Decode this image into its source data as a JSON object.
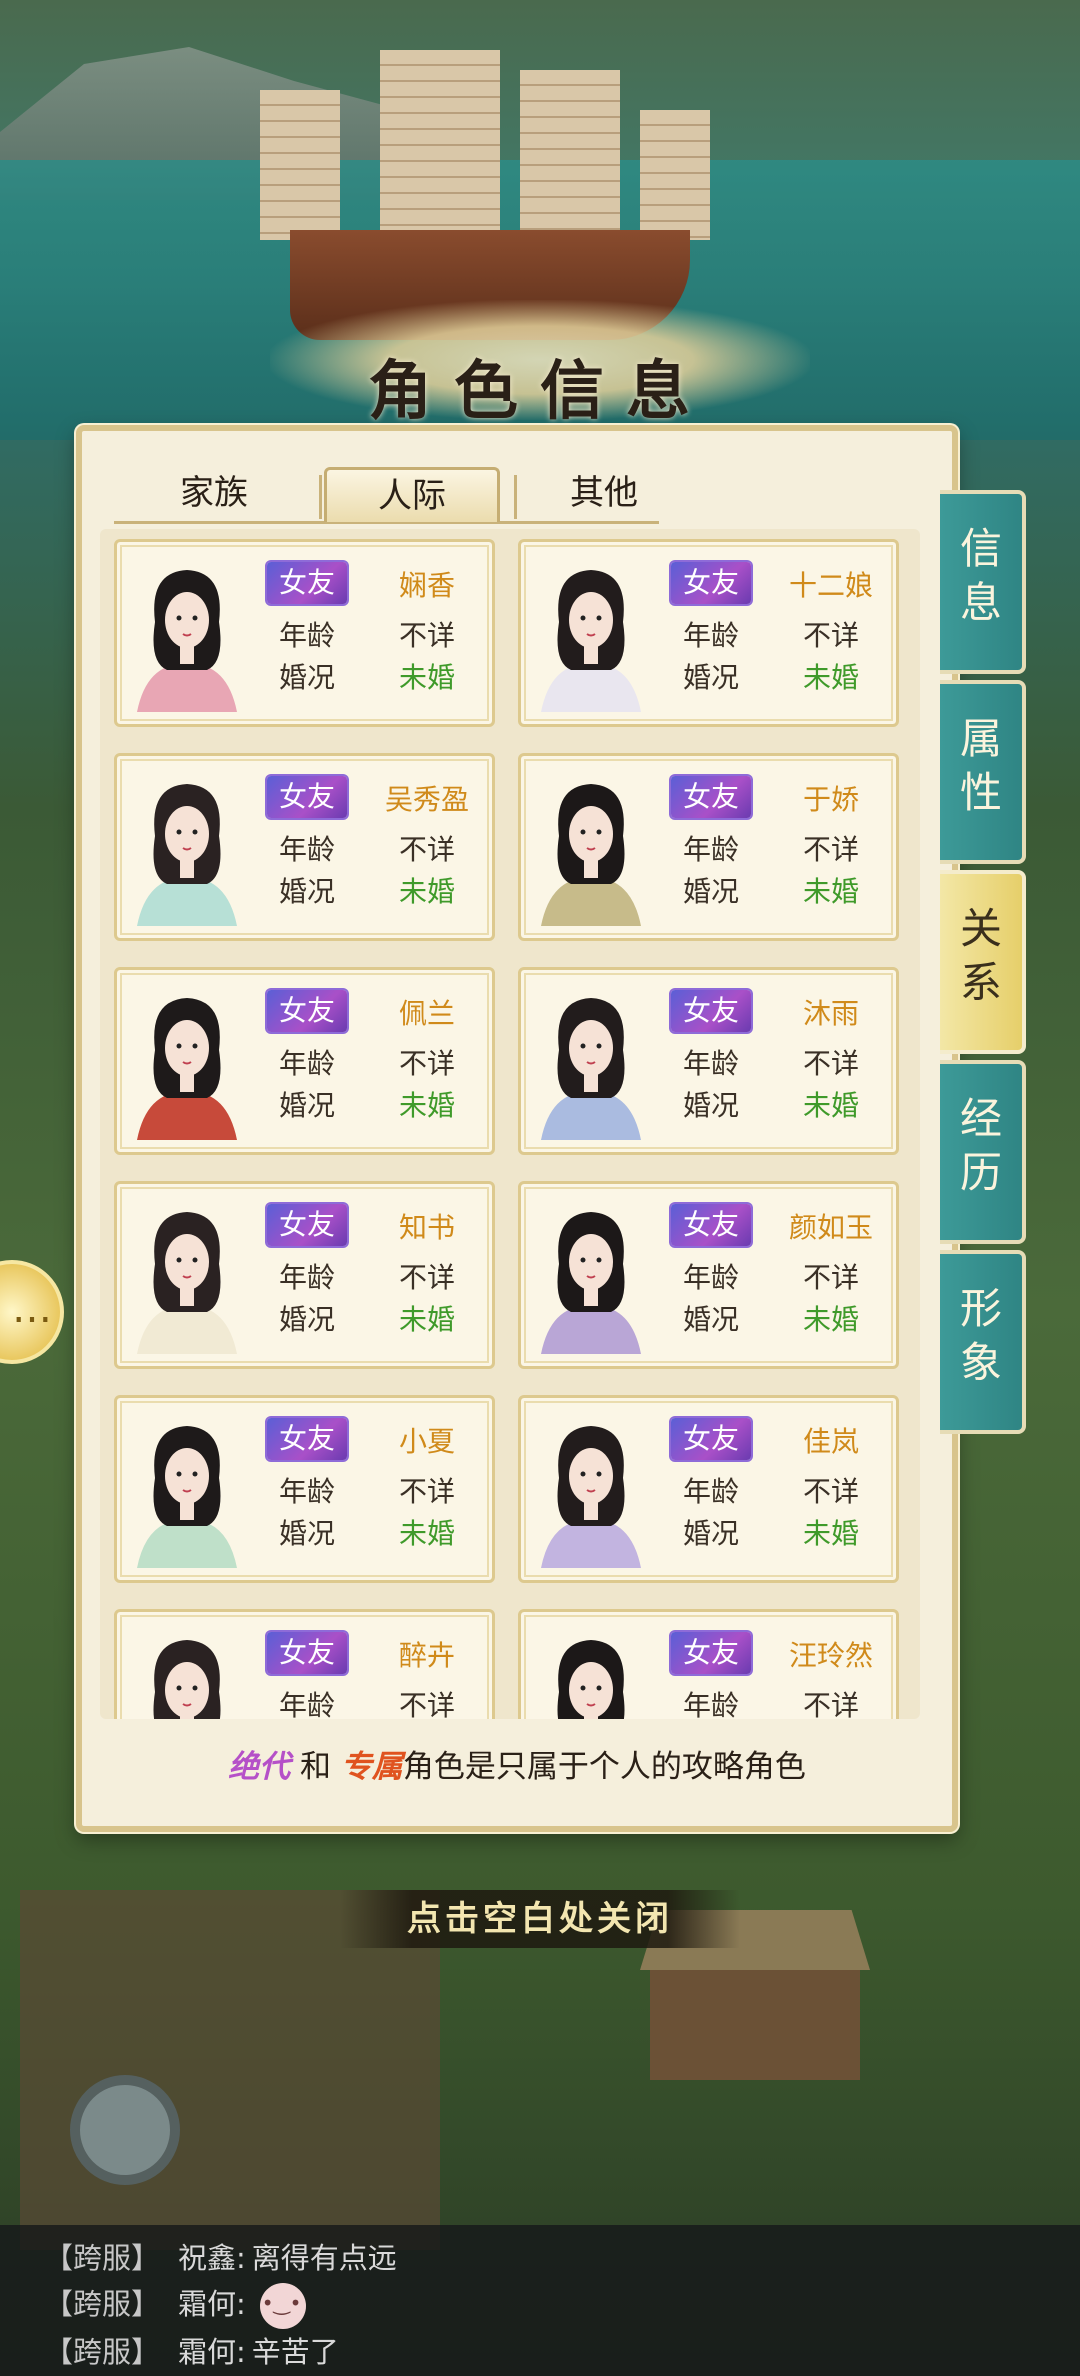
{
  "title": "角色信息",
  "tabs": [
    {
      "label": "家族",
      "active": false
    },
    {
      "label": "人际",
      "active": true
    },
    {
      "label": "其他",
      "active": false
    }
  ],
  "side_tabs": [
    {
      "label": "信息",
      "active": false
    },
    {
      "label": "属性",
      "active": false
    },
    {
      "label": "关系",
      "active": true
    },
    {
      "label": "经历",
      "active": false
    },
    {
      "label": "形象",
      "active": false
    }
  ],
  "labels": {
    "age": "年龄",
    "marital": "婚况"
  },
  "characters": [
    {
      "relation": "女友",
      "name": "娴香",
      "age": "不详",
      "marital": "未婚"
    },
    {
      "relation": "女友",
      "name": "十二娘",
      "age": "不详",
      "marital": "未婚"
    },
    {
      "relation": "女友",
      "name": "吴秀盈",
      "age": "不详",
      "marital": "未婚"
    },
    {
      "relation": "女友",
      "name": "于娇",
      "age": "不详",
      "marital": "未婚"
    },
    {
      "relation": "女友",
      "name": "佩兰",
      "age": "不详",
      "marital": "未婚"
    },
    {
      "relation": "女友",
      "name": "沐雨",
      "age": "不详",
      "marital": "未婚"
    },
    {
      "relation": "女友",
      "name": "知书",
      "age": "不详",
      "marital": "未婚"
    },
    {
      "relation": "女友",
      "name": "颜如玉",
      "age": "不详",
      "marital": "未婚"
    },
    {
      "relation": "女友",
      "name": "小夏",
      "age": "不详",
      "marital": "未婚"
    },
    {
      "relation": "女友",
      "name": "佳岚",
      "age": "不详",
      "marital": "未婚"
    },
    {
      "relation": "女友",
      "name": "醉卉",
      "age": "不详",
      "marital": ""
    },
    {
      "relation": "女友",
      "name": "汪玲然",
      "age": "不详",
      "marital": ""
    }
  ],
  "footer": {
    "tag1": "绝代",
    "mid": "和",
    "tag2": "专属",
    "text": "角色是只属于个人的攻略角色"
  },
  "close_hint": "点击空白处关闭",
  "chat": [
    {
      "server": "【跨服】",
      "user": "祝鑫:",
      "message": "离得有点远"
    },
    {
      "server": "【跨服】",
      "user": "霜何:",
      "message": "",
      "emoji": "smile-emoji"
    },
    {
      "server": "【跨服】",
      "user": "霜何:",
      "message": "辛苦了"
    }
  ],
  "colors": {
    "badge": "#8a55d0",
    "name": "#d08a1a",
    "unmarried": "#3f9a2a",
    "side_tab": "#2f8584",
    "side_tab_active": "#e6cf6a"
  }
}
